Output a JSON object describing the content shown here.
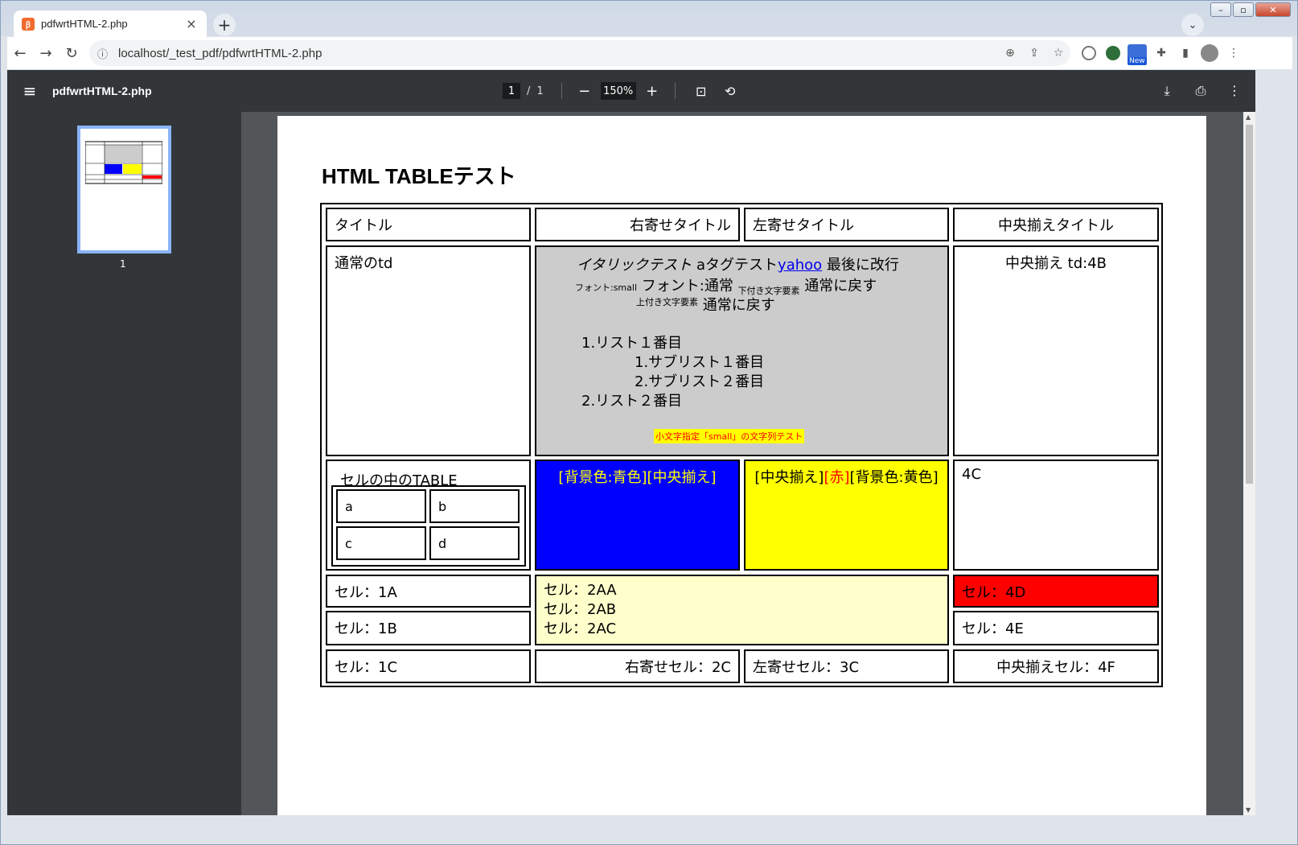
{
  "browser": {
    "tab_title": "pdfwrtHTML-2.php",
    "tab_favicon": "xampp-icon",
    "url": "localhost/_test_pdf/pdfwrtHTML-2.php",
    "new_badge": "New"
  },
  "viewer": {
    "doc_title": "pdfwrtHTML-2.php",
    "page_current": "1",
    "page_separator": "/",
    "page_total": "1",
    "zoom": "150%",
    "thumbnail_page": "1",
    "background": "#525659",
    "toolbar_color": "#323639"
  },
  "document": {
    "heading": "HTML TABLEテスト",
    "row1": {
      "c1": "タイトル",
      "c2": "右寄せタイトル",
      "c3": "左寄せタイトル",
      "c4": "中央揃えタイトル"
    },
    "row2": {
      "c1": "通常のtd",
      "italic_text": "イタリックテスト",
      "a_tag_text": "aタグテスト",
      "link_text": "yahoo",
      "break_text": "最後に改行",
      "font_small": "フォント:small",
      "font_normal": "フォント:通常",
      "sub_text": "下付き文字要素",
      "back_normal_1": "通常に戻す",
      "sup_text": "上付き文字要素",
      "back_normal_2": "通常に戻す",
      "list": [
        {
          "label": "1.リスト１番目",
          "children": [
            "1.サブリスト１番目",
            "2.サブリスト２番目"
          ]
        },
        {
          "label": "2.リスト２番目",
          "children": []
        }
      ],
      "small_test": "小文字指定「small」の文字列テスト",
      "c4": "中央揃え td:4B",
      "c23_background": "#cccccc"
    },
    "row3": {
      "inner_title": "セルの中のTABLE",
      "inner_cells": [
        "a",
        "b",
        "c",
        "d"
      ],
      "blue_cell": "[背景色:青色][中央揃え]",
      "blue_bg": "#0000ff",
      "blue_text_color": "#ffff00",
      "yellow_open": "[中央揃え]",
      "yellow_red": "[赤]",
      "yellow_close": "[背景色:黄色]",
      "yellow_bg": "#ffff00",
      "red_text_color": "#ff0000",
      "c4": "4C"
    },
    "row4": {
      "c1a": "セル：1A",
      "c1b": "セル：1B",
      "c2_lines": [
        "セル：2AA",
        "セル：2AB",
        "セル：2AC"
      ],
      "c2_bg": "#ffffcc",
      "c4a": "セル：4D",
      "c4a_bg": "#ff0000",
      "c4b": "セル：4E"
    },
    "row5": {
      "c1": "セル：1C",
      "c2": "右寄せセル：2C",
      "c3": "左寄せセル：3C",
      "c4": "中央揃えセル：4F"
    }
  }
}
